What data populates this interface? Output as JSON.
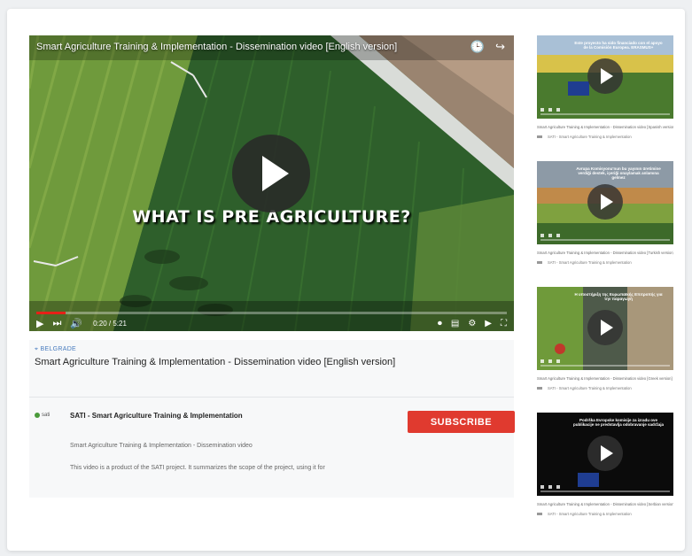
{
  "player": {
    "title": "Smart Agriculture Training & Implementation - Dissemination video [English version]",
    "overlay_text": "WHAT IS PRE  AGRICULTURE?",
    "current_time": "0:20 / 5:21",
    "progress": 0.0625,
    "icons": [
      "clock-icon",
      "share-icon",
      "play-icon",
      "next-icon",
      "volume-icon",
      "settings-icon",
      "subtitles-icon",
      "youtube-logo-icon",
      "fullscreen-icon"
    ]
  },
  "info": {
    "location": "BELGRADE",
    "title": "Smart Agriculture Training & Implementation - Dissemination video [English version]",
    "logo_text": "sati",
    "channel": "SATI - Smart Agriculture Training & Implementation",
    "subscribe_label": "SUBSCRIBE",
    "description_line1": "Smart Agriculture Training & Implementation - Dissemination video",
    "description_line2": "This video is a product of the SATI project. It summarizes the scope of the project, using it for"
  },
  "sidebar": {
    "items": [
      {
        "title": "Smart Agriculture Training & Implementation - Dissemination video [Spanish version]",
        "channel": "SATI - Smart Agriculture Training & Implementation",
        "overlay": "Este proyecto ha sido financiado con el apoyo de la Comisión Europea. ERASMUS+"
      },
      {
        "title": "Smart Agriculture Training & Implementation - Dissemination video [Turkish version]",
        "channel": "SATI - Smart Agriculture Training & Implementation",
        "overlay": "Avrupa Komisyonu'nun bu yayının üretimine verdiği destek, içeriği onaylamak anlamına gelmez"
      },
      {
        "title": "Smart Agriculture Training & Implementation - Dissemination video [Greek version]",
        "channel": "SATI - Smart Agriculture Training & Implementation",
        "overlay": "Η υποστήριξη της Ευρωπαϊκής Επιτροπής για την παραγωγή"
      },
      {
        "title": "Smart Agriculture Training & Implementation - Dissemination video [Serbian version]",
        "channel": "SATI - Smart Agriculture Training & Implementation",
        "overlay": "Podrška Evropske komisije za izradu ove publikacije ne predstavlja odobravanje sadržaja"
      }
    ]
  }
}
